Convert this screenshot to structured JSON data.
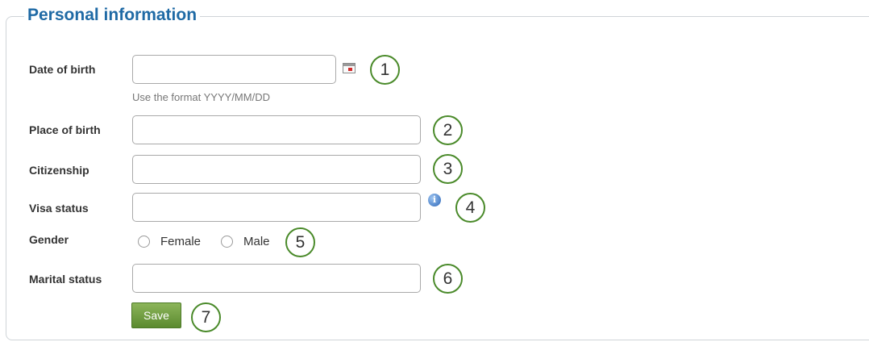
{
  "fieldset": {
    "legend": "Personal information"
  },
  "fields": {
    "date_of_birth": {
      "label": "Date of birth",
      "value": "",
      "hint": "Use the format YYYY/MM/DD"
    },
    "place_of_birth": {
      "label": "Place of birth",
      "value": ""
    },
    "citizenship": {
      "label": "Citizenship",
      "value": ""
    },
    "visa_status": {
      "label": "Visa status",
      "value": ""
    },
    "gender": {
      "label": "Gender",
      "options": [
        "Female",
        "Male"
      ],
      "selected": null
    },
    "marital_status": {
      "label": "Marital status",
      "value": ""
    }
  },
  "save_label": "Save",
  "callouts": [
    "1",
    "2",
    "3",
    "4",
    "5",
    "6",
    "7"
  ],
  "icons": {
    "calendar": "calendar-icon",
    "info": "info-icon"
  },
  "colors": {
    "legend": "#1f6aa5",
    "callout_border": "#4a8a2a",
    "button": "#6a9a3a"
  }
}
